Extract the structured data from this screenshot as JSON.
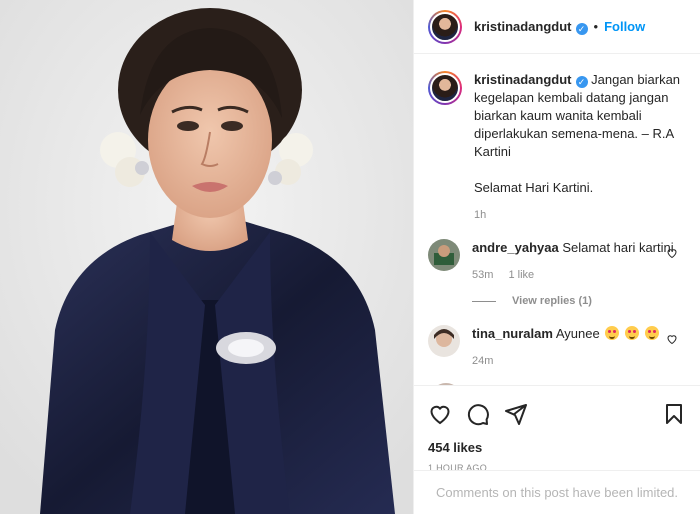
{
  "post": {
    "username": "kristinadangdut",
    "verified_mark": "✓",
    "dot": "•",
    "follow_label": "Follow",
    "caption_p1": "Jangan biarkan kegelapan kembali datang jangan biarkan kaum wanita kembali diperlakukan semena-mena. – R.A Kartini",
    "caption_p2": "Selamat Hari Kartini.",
    "caption_age": "1h"
  },
  "comments": [
    {
      "username": "andre_yahyaa",
      "text": "Selamat hari kartini",
      "age": "53m",
      "likes": "1 like",
      "view_replies": "View replies (1)"
    },
    {
      "username": "tina_nuralam",
      "text": "Ayunee",
      "age": "24m"
    }
  ],
  "footer": {
    "likes": "454 likes",
    "timestamp": "1 HOUR AGO",
    "comments_limited": "Comments on this post have been limited."
  },
  "icons": {
    "like": "heart-icon",
    "comment": "comment-icon",
    "share": "paper-plane-icon",
    "save": "bookmark-icon"
  },
  "colors": {
    "link_blue": "#0095f6",
    "verified_blue": "#3897f0",
    "muted": "#8e8e8e",
    "background_photo": "#ececec",
    "kebaya_navy": "#1b2140"
  }
}
